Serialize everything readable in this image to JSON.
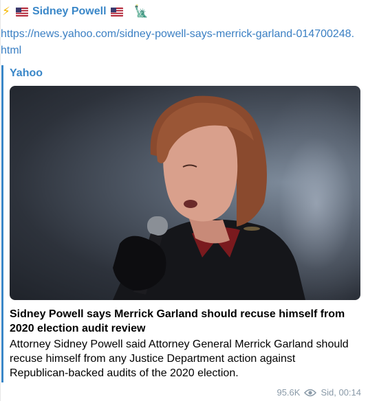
{
  "header": {
    "bolt_icon": "⚡",
    "sender_name": "Sidney Powell",
    "flag_icon": "us-flag-icon",
    "liberty_icon": "🗽"
  },
  "message": {
    "link_text": "https://news.yahoo.com/sidney-powell-says-merrick-garland-014700248.html"
  },
  "preview": {
    "site_name": "Yahoo",
    "title": "Sidney Powell says Merrick Garland should recuse himself from 2020 election audit review",
    "description": "Attorney Sidney Powell said Attorney General Merrick Garland should recuse himself from any Justice Department action against Republican-backed audits of the 2020 election."
  },
  "meta": {
    "views": "95.6K",
    "author_time": "Sid, 00:14"
  },
  "colors": {
    "accent": "#3a87c8",
    "link": "#3a7fc3",
    "meta": "#8a9aa8"
  }
}
